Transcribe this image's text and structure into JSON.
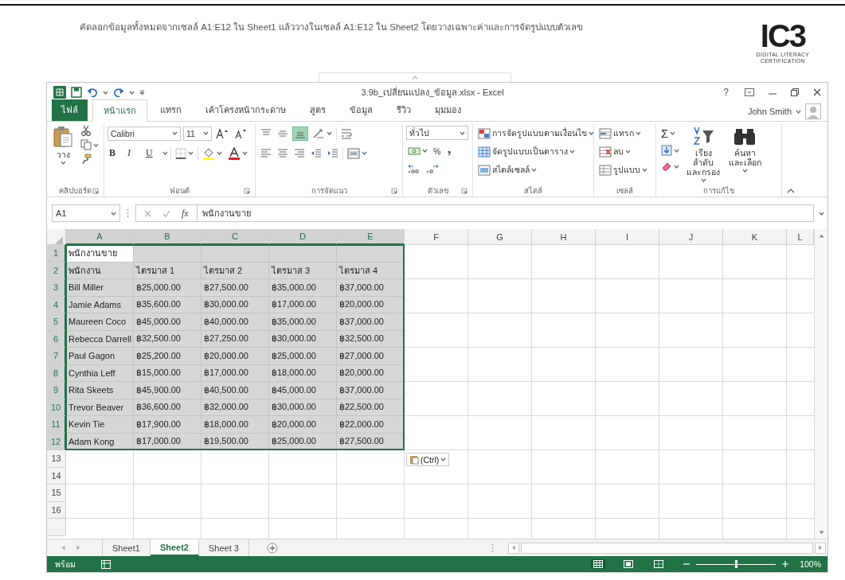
{
  "instruction": "คัดลอกข้อมูลทั้งหมดจากเซลล์ A1:E12 ใน Sheet1 แล้ววางในเซลล์ A1:E12 ใน Sheet2 โดยวางเฉพาะค่าและการจัดรูปแบบตัวเลข",
  "logo": {
    "mark": "IC3",
    "line_1": "DIGITAL LITERACY",
    "line_2": "CERTIFICATION"
  },
  "window": {
    "title": "3.9b_เปลี่ยนแปลง_ข้อมูล.xlsx - Excel",
    "help": "?",
    "user": "John Smith"
  },
  "ribbon_tabs": [
    {
      "label": "ไฟล์",
      "kind": "file",
      "selected": false
    },
    {
      "label": "หน้าแรก",
      "kind": "tab",
      "selected": true
    },
    {
      "label": "แทรก",
      "kind": "tab",
      "selected": false
    },
    {
      "label": "เค้าโครงหน้ากระดาษ",
      "kind": "tab",
      "selected": false
    },
    {
      "label": "สูตร",
      "kind": "tab",
      "selected": false
    },
    {
      "label": "ข้อมูล",
      "kind": "tab",
      "selected": false
    },
    {
      "label": "รีวิว",
      "kind": "tab",
      "selected": false
    },
    {
      "label": "มุมมอง",
      "kind": "tab",
      "selected": false
    }
  ],
  "ribbon": {
    "clipboard": {
      "label": "คลิปบอร์ด",
      "paste": "วาง"
    },
    "font": {
      "label": "ฟอนต์",
      "font_name": "Calibri",
      "font_size": "11",
      "format_buttons": [
        "B",
        "I",
        "U"
      ]
    },
    "alignment": {
      "label": "การจัดแนว",
      "vertical_buttons": [
        {
          "kind": "top",
          "selected": false
        },
        {
          "kind": "middle",
          "selected": false
        },
        {
          "kind": "bottom",
          "selected": true
        }
      ]
    },
    "number": {
      "label": "ตัวเลข",
      "format": "ทั่วไป",
      "percent": "%"
    },
    "styles": {
      "label": "สไตล์",
      "items": [
        "การจัดรูปแบบตามเงื่อนไข",
        "จัดรูปแบบเป็นตาราง",
        "สไตล์เซลล์"
      ]
    },
    "cells": {
      "label": "เซลล์",
      "items": [
        "แทรก",
        "ลบ",
        "รูปแบบ"
      ]
    },
    "editing": {
      "label": "การแก้ไข",
      "sum": "Σ",
      "sort": "เรียงลำดับและกรอง",
      "find": "ค้นหาและเลือก"
    }
  },
  "formula_bar": {
    "name_box": "A1",
    "function_label": "fx",
    "value": "พนักงานขาย"
  },
  "sheet": {
    "columns": [
      {
        "label": "A",
        "selected": true
      },
      {
        "label": "B",
        "selected": true
      },
      {
        "label": "C",
        "selected": true
      },
      {
        "label": "D",
        "selected": true
      },
      {
        "label": "E",
        "selected": true
      },
      {
        "label": "F",
        "selected": false
      },
      {
        "label": "G",
        "selected": false
      },
      {
        "label": "H",
        "selected": false
      },
      {
        "label": "I",
        "selected": false
      },
      {
        "label": "J",
        "selected": false
      },
      {
        "label": "K",
        "selected": false
      },
      {
        "label": "L",
        "selected": false
      }
    ],
    "rows": [
      {
        "number": "1",
        "selected": true,
        "active_cell": true,
        "cells": [
          "พนักงานขาย"
        ]
      },
      {
        "number": "2",
        "selected": true,
        "active_cell": false,
        "cells": [
          "พนักงาน",
          "ไตรมาส 1",
          "ไตรมาส 2",
          "ไตรมาส 3",
          "ไตรมาส 4"
        ]
      },
      {
        "number": "3",
        "selected": true,
        "active_cell": false,
        "cells": [
          "Bill Miller",
          "฿25,000.00",
          "฿27,500.00",
          "฿35,000.00",
          "฿37,000.00"
        ]
      },
      {
        "number": "4",
        "selected": true,
        "active_cell": false,
        "cells": [
          "Jamie Adams",
          "฿35,600.00",
          "฿30,000.00",
          "฿17,000.00",
          "฿20,000.00"
        ]
      },
      {
        "number": "5",
        "selected": true,
        "active_cell": false,
        "cells": [
          "Maureen Coco",
          "฿45,000.00",
          "฿40,000.00",
          "฿35,000.00",
          "฿37,000.00"
        ]
      },
      {
        "number": "6",
        "selected": true,
        "active_cell": false,
        "cells": [
          "Rebecca Darrell",
          "฿32,500.00",
          "฿27,250.00",
          "฿30,000.00",
          "฿32,500.00"
        ]
      },
      {
        "number": "7",
        "selected": true,
        "active_cell": false,
        "cells": [
          "Paul Gagon",
          "฿25,200.00",
          "฿20,000.00",
          "฿25,000.00",
          "฿27,000.00"
        ]
      },
      {
        "number": "8",
        "selected": true,
        "active_cell": false,
        "cells": [
          "Cynthia Leff",
          "฿15,000.00",
          "฿17,000.00",
          "฿18,000.00",
          "฿20,000.00"
        ]
      },
      {
        "number": "9",
        "selected": true,
        "active_cell": false,
        "cells": [
          "Rita Skeets",
          "฿45,900.00",
          "฿40,500.00",
          "฿45,000.00",
          "฿37,000.00"
        ]
      },
      {
        "number": "10",
        "selected": true,
        "active_cell": false,
        "cells": [
          "Trevor Beaver",
          "฿36,600.00",
          "฿32,000.00",
          "฿30,000.00",
          "฿22,500.00"
        ]
      },
      {
        "number": "11",
        "selected": true,
        "active_cell": false,
        "cells": [
          "Kevin Tie",
          "฿17,900.00",
          "฿18,000.00",
          "฿20,000.00",
          "฿22,000.00"
        ]
      },
      {
        "number": "12",
        "selected": true,
        "active_cell": false,
        "cells": [
          "Adam Kong",
          "฿17,000.00",
          "฿19,500.00",
          "฿25,000.00",
          "฿27,500.00"
        ]
      },
      {
        "number": "13",
        "selected": false,
        "active_cell": false
      },
      {
        "number": "14",
        "selected": false,
        "active_cell": false
      },
      {
        "number": "15",
        "selected": false,
        "active_cell": false
      },
      {
        "number": "16",
        "selected": false,
        "active_cell": false
      }
    ]
  },
  "paste_options": "(Ctrl)",
  "sheet_tabs": [
    {
      "label": "Sheet1",
      "selected": false
    },
    {
      "label": "Sheet2",
      "selected": true
    },
    {
      "label": "Sheet 3",
      "selected": false
    }
  ],
  "status_bar": {
    "mode": "พร้อม",
    "zoom": "100%",
    "zoom_slider": {
      "level": 0.5
    }
  }
}
